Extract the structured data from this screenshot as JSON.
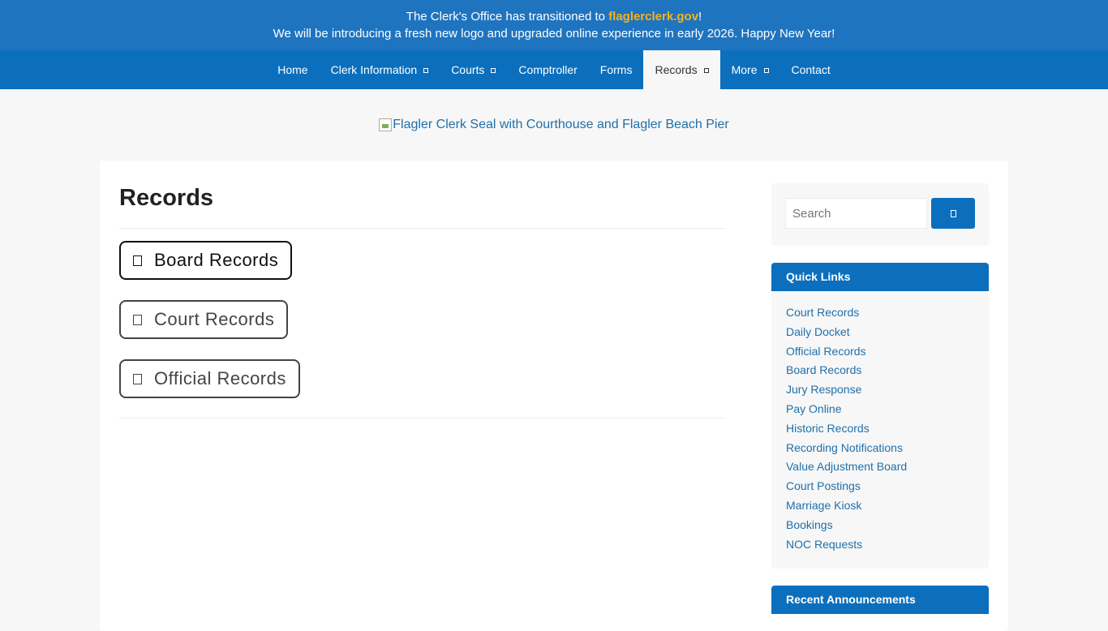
{
  "banner": {
    "line1_prefix": "The Clerk's Office has transitioned to ",
    "line1_link": "flaglerclerk.gov",
    "line1_suffix": "!",
    "line2": "We will be introducing a fresh new logo and upgraded online experience in early 2026. Happy New Year!"
  },
  "nav": {
    "home": "Home",
    "clerk_info": "Clerk Information",
    "courts": "Courts",
    "comptroller": "Comptroller",
    "forms": "Forms",
    "records": "Records",
    "more": "More",
    "contact": "Contact"
  },
  "logo": {
    "alt_text": "Flagler Clerk Seal with Courthouse and Flagler Beach Pier"
  },
  "main": {
    "title": "Records",
    "buttons": [
      "Board Records",
      "Court Records",
      "Official Records"
    ]
  },
  "sidebar": {
    "search_placeholder": "Search",
    "quick_links_title": "Quick Links",
    "quick_links": [
      "Court Records",
      "Daily Docket",
      "Official Records",
      "Board Records",
      "Jury Response",
      "Pay Online",
      "Historic Records",
      "Recording Notifications",
      "Value Adjustment Board",
      "Court Postings",
      "Marriage Kiosk",
      "Bookings",
      "NOC Requests"
    ],
    "announcements_title": "Recent Announcements"
  },
  "colors": {
    "primary": "#0b6fbd",
    "banner": "#1f74c0",
    "link": "#1f6fab",
    "highlight": "#f6b21a"
  }
}
